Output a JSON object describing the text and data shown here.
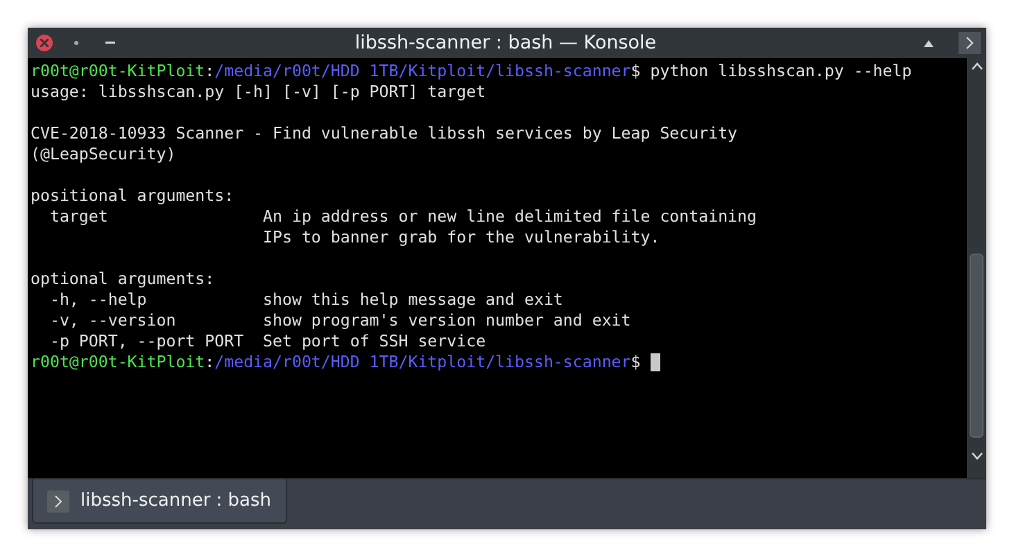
{
  "window": {
    "title": "libssh-scanner : bash — Konsole"
  },
  "terminal": {
    "lines": [
      {
        "kind": "prompt",
        "user_host": "r00t@r00t-KitPloit",
        "separator": ":",
        "path": "/media/r00t/HDD 1TB/Kitploit/libssh-scanner",
        "symbol": "$",
        "command": "python libsshscan.py --help",
        "cursor": false
      },
      {
        "kind": "output",
        "text": "usage: libsshscan.py [-h] [-v] [-p PORT] target"
      },
      {
        "kind": "blank"
      },
      {
        "kind": "output",
        "text": "CVE-2018-10933 Scanner - Find vulnerable libssh services by Leap Security"
      },
      {
        "kind": "output",
        "text": "(@LeapSecurity)"
      },
      {
        "kind": "blank"
      },
      {
        "kind": "output",
        "text": "positional arguments:"
      },
      {
        "kind": "output",
        "text": "  target                An ip address or new line delimited file containing"
      },
      {
        "kind": "output",
        "text": "                        IPs to banner grab for the vulnerability."
      },
      {
        "kind": "blank"
      },
      {
        "kind": "output",
        "text": "optional arguments:"
      },
      {
        "kind": "output",
        "text": "  -h, --help            show this help message and exit"
      },
      {
        "kind": "output",
        "text": "  -v, --version         show program's version number and exit"
      },
      {
        "kind": "output",
        "text": "  -p PORT, --port PORT  Set port of SSH service"
      },
      {
        "kind": "prompt",
        "user_host": "r00t@r00t-KitPloit",
        "separator": ":",
        "path": "/media/r00t/HDD 1TB/Kitploit/libssh-scanner",
        "symbol": "$",
        "cursor": true
      }
    ]
  },
  "tabs": [
    {
      "label": "libssh-scanner : bash",
      "selected": true
    }
  ]
}
